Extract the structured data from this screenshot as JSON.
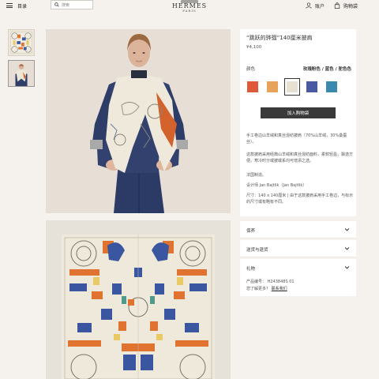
{
  "header": {
    "menu_label": "目录",
    "search_placeholder": "搜索",
    "brand": "HERMES",
    "city": "PARIS",
    "account_label": "账户",
    "cart_label": "购物袋"
  },
  "product": {
    "title": "“跳跃的骅骝”140厘米披肩",
    "price": "¥4,100",
    "color_label": "颜色",
    "color_selected": "玫瑰粉色 / 蓝色 / 驼色色",
    "swatches": [
      {
        "name": "swatch-1",
        "color": "#e05a3a"
      },
      {
        "name": "swatch-2",
        "color": "#e8a35a"
      },
      {
        "name": "swatch-3",
        "color": "#e6e1d2"
      },
      {
        "name": "swatch-4",
        "color": "#4a5aa0"
      },
      {
        "name": "swatch-5",
        "color": "#3a8ab0"
      }
    ],
    "selected_swatch": 2,
    "cart_button": "加入购物袋",
    "desc1": "手工卷边山羊绒和真丝混纺披肩（70%山羊绒，30%桑蚕丝）。",
    "desc2": "这款披肩采用经典山羊绒和真丝混纺面料，柔软轻盈，飘逸方便。寒冷时分或披或系均可增添之选。",
    "desc3": "法国制造。",
    "desc4": "设计师 Jan Bajtlik（Jan Bajtlik）",
    "desc5": "尺寸：140 x 140厘米 | 由于这款披肩采用手工卷边，与标示的尺寸或有略有不同。"
  },
  "accordion": [
    {
      "label": "保养"
    },
    {
      "label": "送货与退货"
    },
    {
      "label": "礼物"
    }
  ],
  "info": {
    "code_label": "产品编号：",
    "code_value": "H243848S 01",
    "question": "您了解更多？",
    "contact": "联系我们"
  },
  "colors": {
    "page_bg": "#f5f2ee",
    "button": "#3a3a3a"
  }
}
